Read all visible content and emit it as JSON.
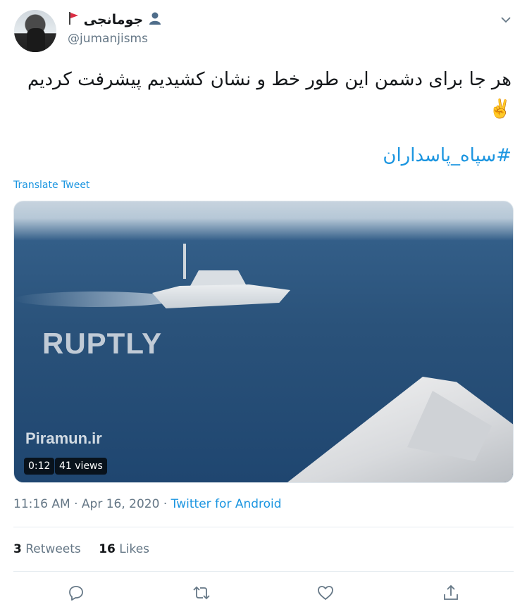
{
  "user": {
    "display_name": "جومانجی",
    "handle": "@jumanjisms"
  },
  "tweet": {
    "text": "هر جا برای دشمن این طور خط و نشان کشیدیم پیشرفت کردیم ✌️",
    "hashtag": "#سپاه_پاسداران",
    "translate_label": "Translate Tweet"
  },
  "media": {
    "watermark": "RUPTLY",
    "site_label": "Piramun.ir",
    "duration": "0:12",
    "views": "41 views"
  },
  "meta": {
    "time": "11:16 AM",
    "separator1": " · ",
    "date": "Apr 16, 2020",
    "separator2": " · ",
    "app": "Twitter for Android"
  },
  "stats": {
    "retweets_count": "3",
    "retweets_label": "Retweets",
    "likes_count": "16",
    "likes_label": "Likes"
  },
  "icons": {
    "reply": "reply-icon",
    "retweet": "retweet-icon",
    "like": "heart-icon",
    "share": "share-icon",
    "caret": "chevron-down-icon"
  },
  "colors": {
    "link": "#1b95e0",
    "secondary_text": "#657786",
    "primary_text": "#14171a"
  }
}
